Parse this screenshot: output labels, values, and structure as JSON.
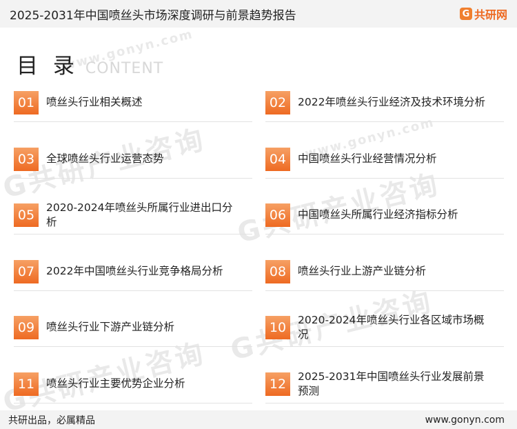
{
  "header": {
    "title": "2025-2031年中国喷丝头市场深度调研与前景趋势报告",
    "logo_mark": "G",
    "logo_text": "共研网"
  },
  "toc": {
    "title": "目 录",
    "subtitle": "CONTENT"
  },
  "items": [
    {
      "num": "01",
      "label": "喷丝头行业相关概述"
    },
    {
      "num": "02",
      "label": "2022年喷丝头行业经济及技术环境分析"
    },
    {
      "num": "03",
      "label": "全球喷丝头行业运营态势"
    },
    {
      "num": "04",
      "label": "中国喷丝头行业经营情况分析"
    },
    {
      "num": "05",
      "label": "2020-2024年喷丝头所属行业进出口分析"
    },
    {
      "num": "06",
      "label": "中国喷丝头所属行业经济指标分析"
    },
    {
      "num": "07",
      "label": "2022年中国喷丝头行业竞争格局分析"
    },
    {
      "num": "08",
      "label": "喷丝头行业上游产业链分析"
    },
    {
      "num": "09",
      "label": "喷丝头行业下游产业链分析"
    },
    {
      "num": "10",
      "label": "2020-2024年喷丝头行业各区域市场概况"
    },
    {
      "num": "11",
      "label": "喷丝头行业主要优势企业分析"
    },
    {
      "num": "12",
      "label": "2025-2031年中国喷丝头行业发展前景预测"
    }
  ],
  "watermark": {
    "text": "G共研产业咨询",
    "url": "www.gonyn.com"
  },
  "footer": {
    "slogan": "共研出品，必属精品",
    "url": "www.gonyn.com"
  }
}
